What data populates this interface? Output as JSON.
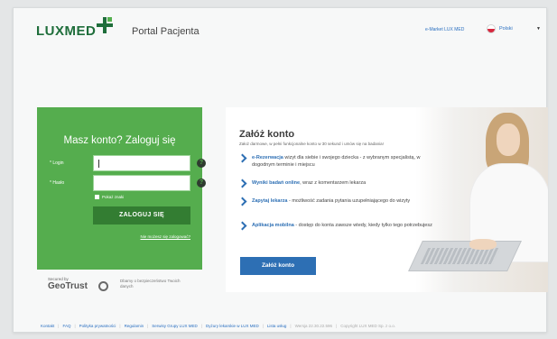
{
  "header": {
    "logo_text": "LUXMED",
    "portal_title": "Portal Pacjenta",
    "emarket_link": "e-Market LUX MED",
    "language": "Polski"
  },
  "login": {
    "title": "Masz konto? Zaloguj się",
    "login_label": "* Login",
    "password_label": "* Hasło",
    "remember_label": "Pokaż znaki",
    "submit_label": "ZALOGUJ SIĘ",
    "forgot_link": "Nie możesz się zalogować?"
  },
  "security": {
    "secured_by": "Secured by",
    "brand": "GeoTrust",
    "description": "Dbamy o bezpieczeństwo Twoich danych"
  },
  "register": {
    "title": "Załóż konto",
    "subtitle": "Założ darmowe, w pełni funkcjonalne konto w 30 sekund i umów się na badania!",
    "features": [
      {
        "bold": "e-Rezerwacja",
        "text": " wizyt dla siebie i swojego dziecka - z wybranym specjalistą, w dogodnym terminie i miejscu"
      },
      {
        "bold": "Wyniki badań online",
        "text": ", wraz z komentarzem lekarza"
      },
      {
        "bold": "Zapytaj lekarza",
        "text": " - możliwość zadania pytania uzupełniającego do wizyty"
      },
      {
        "bold": "Aplikacja mobilna",
        "text": " - dostęp do konta zawsze wtedy, kiedy tylko tego potrzebujesz"
      }
    ],
    "button_label": "Załóż konto"
  },
  "footer": {
    "links": [
      "Kontakt",
      "FAQ",
      "Polityka prywatności",
      "Regulamin",
      "Serwisy Grupy LUX MED",
      "Dyżury lekarskie w LUX MED",
      "Lista usług"
    ],
    "version": "Wersja 22.30.22.596",
    "copyright": "Copyright LUX MED Sp. z o.o."
  }
}
